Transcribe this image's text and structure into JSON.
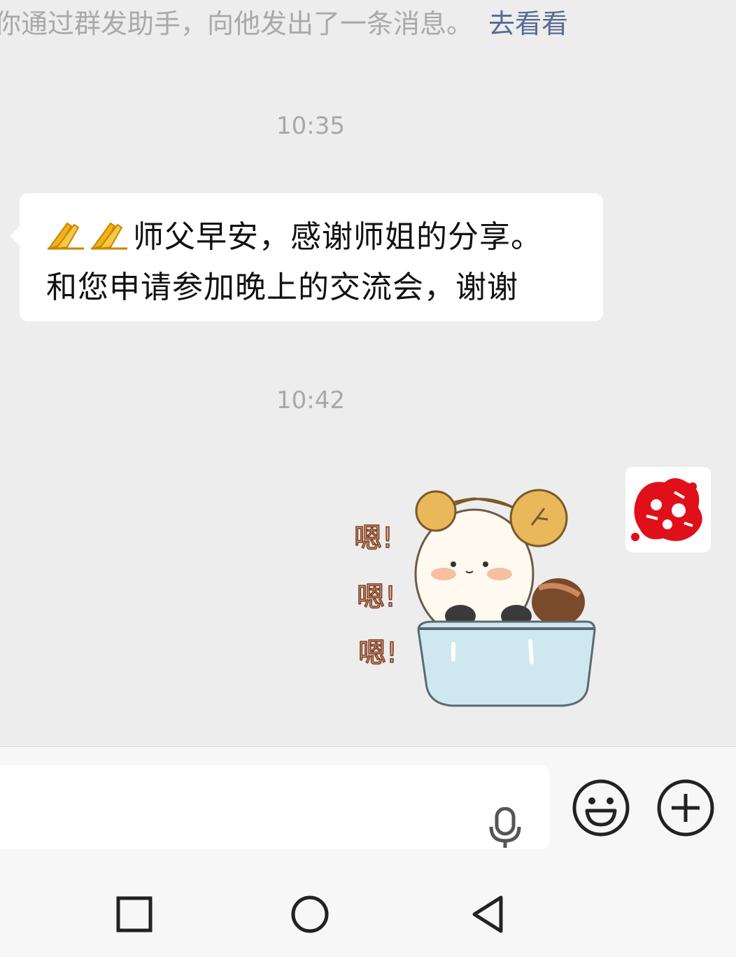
{
  "system_notice": {
    "text": "你通过群发助手，向他发出了一条消息。",
    "link": "去看看"
  },
  "messages": [
    {
      "timestamp": "10:35",
      "sender": "contact",
      "text_line1": "师父早安，感谢师姐的分享。",
      "text_line2": "和您申请参加晚上的交流会，谢谢",
      "emoji_prefix": "folded-hands-icon x2"
    },
    {
      "timestamp": "10:42",
      "sender": "self",
      "sticker_text": [
        "嗯!",
        "嗯!",
        "嗯!"
      ]
    }
  ],
  "input_bar": {
    "mic_icon": "microphone-icon",
    "emoji_icon": "smiley-icon",
    "plus_icon": "plus-icon"
  },
  "nav_bar": {
    "icons": [
      "recent-apps-icon",
      "home-icon",
      "back-icon"
    ]
  },
  "colors": {
    "background": "#ededed",
    "link": "#576b95",
    "bubble": "#ffffff",
    "avatar_art": "#e0101a"
  }
}
